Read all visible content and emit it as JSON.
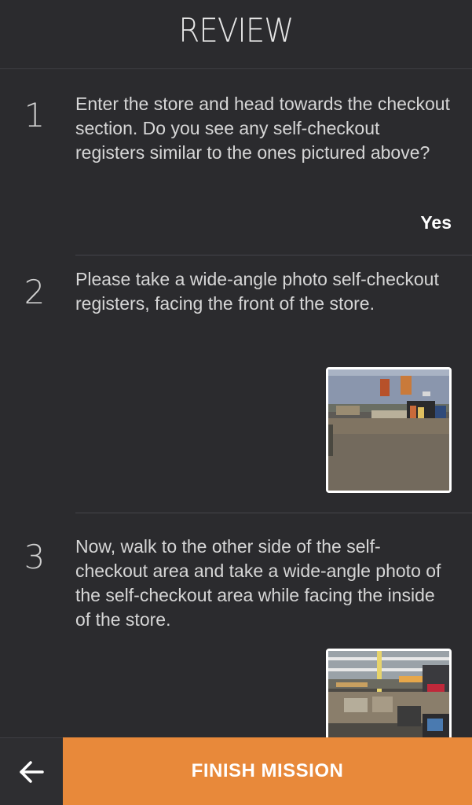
{
  "header": {
    "title": "REVIEW"
  },
  "steps": [
    {
      "number": "1",
      "text": "Enter the store and head towards the checkout section.  Do you see any self-checkout registers similar to the ones pictured above?",
      "answer": "Yes"
    },
    {
      "number": "2",
      "text": "Please take a wide-angle photo self-checkout registers, facing the front of the store.",
      "photo": "self-checkout-front-photo"
    },
    {
      "number": "3",
      "text": "Now, walk to the other side of the self-checkout area and take a wide-angle photo of the self-checkout area while facing the inside of the store.",
      "photo": "self-checkout-inside-photo"
    }
  ],
  "footer": {
    "back_icon": "arrow-left-icon",
    "finish_label": "FINISH MISSION"
  },
  "colors": {
    "background": "#2b2b2e",
    "accent": "#e8893a",
    "text": "#d6d6d6"
  }
}
